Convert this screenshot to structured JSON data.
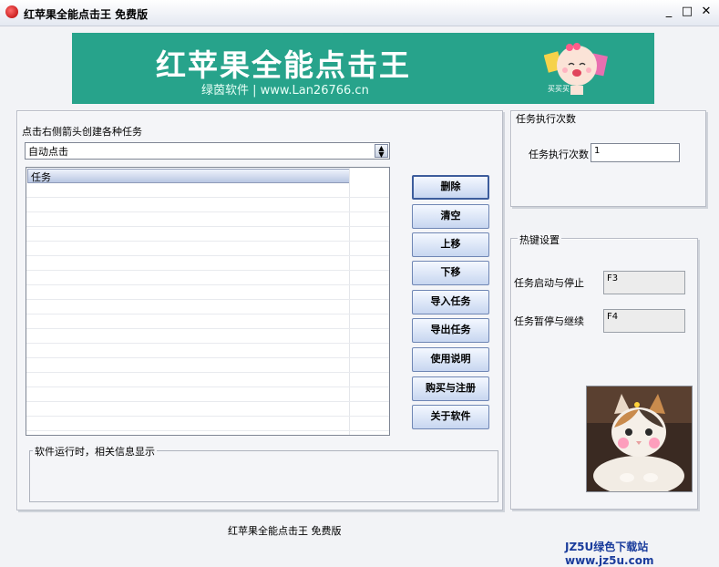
{
  "window": {
    "title": "红苹果全能点击王   免费版",
    "min": "_",
    "max": "□",
    "close": "✕"
  },
  "banner": {
    "title": "红苹果全能点击王",
    "subtitle": "绿茵软件 | www.Lan26766.cn",
    "mascot_text": "买买买"
  },
  "task_panel": {
    "instruction": "点击右侧箭头创建各种任务",
    "dropdown_value": "自动点击",
    "list_header": "任务"
  },
  "buttons": [
    "删除",
    "清空",
    "上移",
    "下移",
    "导入任务",
    "导出任务",
    "使用说明",
    "购买与注册",
    "关于软件"
  ],
  "log": {
    "label": "软件运行时，相关信息显示"
  },
  "exec": {
    "group_label": "任务执行次数",
    "field_label": "任务执行次数",
    "value": "1"
  },
  "hotkeys": {
    "group_label": "热键设置",
    "start_label": "任务启动与停止",
    "start_key": "F3",
    "pause_label": "任务暂停与继续",
    "pause_key": "F4"
  },
  "status": "红苹果全能点击王  免费版",
  "watermark": "JZ5U绿色下载站www.jz5u.com",
  "colors": {
    "banner": "#27a38b",
    "button_top": "#f4f8ff",
    "button_bottom": "#c7d6f0",
    "button_border": "#6f86b4"
  }
}
